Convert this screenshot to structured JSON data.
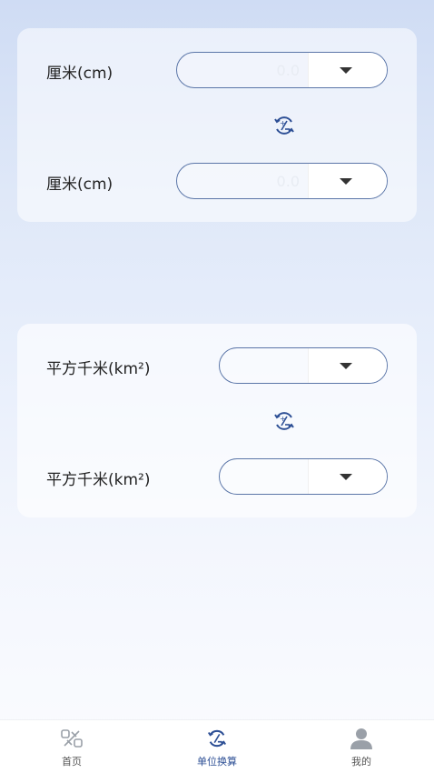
{
  "converter_length": {
    "from": {
      "unit": "厘米(cm)",
      "value": "0.0"
    },
    "to": {
      "unit": "厘米(cm)",
      "value": "0.0"
    },
    "swap_icon": "swap-convert-icon"
  },
  "converter_area": {
    "from": {
      "unit": "平方千米(km²)",
      "value": ""
    },
    "to": {
      "unit": "平方千米(km²)",
      "value": ""
    },
    "swap_icon": "swap-convert-icon"
  },
  "tabs": [
    {
      "label": "首页",
      "icon": "home-icon",
      "active": false
    },
    {
      "label": "单位换算",
      "icon": "convert-icon",
      "active": true
    },
    {
      "label": "我的",
      "icon": "user-icon",
      "active": false
    }
  ],
  "colors": {
    "accent": "#2d4f95",
    "border": "#5b76a8"
  }
}
